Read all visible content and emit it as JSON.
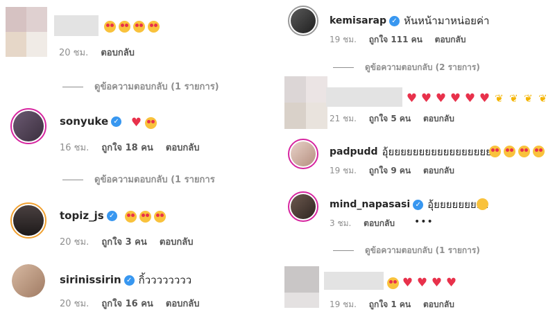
{
  "left": {
    "c1": {
      "emoji": [
        "heart-eyes",
        "heart-eyes",
        "heart-eyes",
        "heart-eyes"
      ],
      "time": "20 ชม.",
      "reply": "ตอบกลับ"
    },
    "r1": "ดูข้อความตอบกลับ (1 รายการ)",
    "c2": {
      "username": "sonyuke",
      "emoji": [
        "heart",
        "heart-eyes"
      ],
      "time": "16 ชม.",
      "likes": "ถูกใจ 18 คน",
      "reply": "ตอบกลับ"
    },
    "r2": "ดูข้อความตอบกลับ (1 รายการ",
    "c3": {
      "username": "topiz_js",
      "emoji": [
        "heart-eyes",
        "heart-eyes",
        "heart-eyes"
      ],
      "time": "20 ชม.",
      "likes": "ถูกใจ 3 คน",
      "reply": "ตอบกลับ"
    },
    "c4": {
      "username": "sirinissirin",
      "text": "กิ้วววววววว",
      "time": "20 ชม.",
      "likes": "ถูกใจ 16 คน",
      "reply": "ตอบกลับ"
    }
  },
  "right": {
    "c1": {
      "username": "kemisarap",
      "text": "หันหน้ามาหน่อยค่า",
      "time": "19 ชม.",
      "likes": "ถูกใจ 111 คน",
      "reply": "ตอบกลับ"
    },
    "r1": "ดูข้อความตอบกลับ (2 รายการ)",
    "c2": {
      "emoji": [
        "heart",
        "heart",
        "heart",
        "heart",
        "heart",
        "heart",
        "hands",
        "hands",
        "hands",
        "hands"
      ],
      "time": "21 ชม.",
      "likes": "ถูกใจ 5 คน",
      "reply": "ตอบกลับ"
    },
    "c3": {
      "username": "padpudd",
      "text": "อุ้ยยยยยยยยยยยยยยยยยย",
      "emoji": [
        "heart-eyes",
        "heart-eyes",
        "heart-eyes",
        "heart-eyes"
      ],
      "time": "19 ชม.",
      "likes": "ถูกใจ 9 คน",
      "reply": "ตอบกลับ"
    },
    "c4": {
      "username": "mind_napasasi",
      "text": "อุ้ยยยยยยยยย",
      "emoji": [
        "blush"
      ],
      "time": "3 ชม.",
      "reply": "ตอบกลับ",
      "more": "•••"
    },
    "r4": "ดูข้อความตอบกลับ (1 รายการ)",
    "c5": {
      "emoji": [
        "heart-eyes",
        "heart",
        "heart",
        "heart",
        "heart"
      ],
      "time": "19 ชม.",
      "likes": "ถูกใจ 1 คน",
      "reply": "ตอบกลับ"
    }
  },
  "colors": {
    "verified": "#3897f0",
    "heart": "#e8314b",
    "muted": "#8e8e8e"
  }
}
